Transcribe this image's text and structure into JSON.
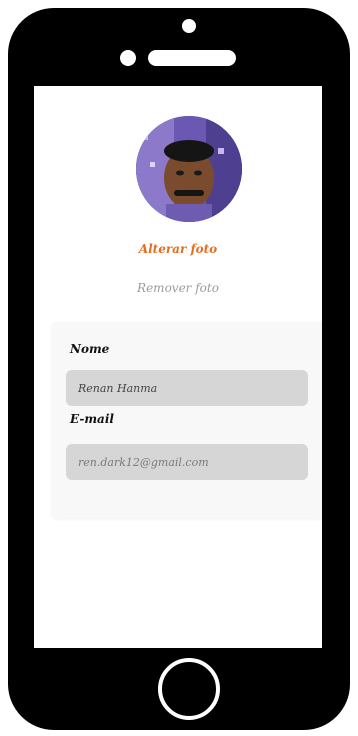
{
  "profile": {
    "change_photo_label": "Alterar foto",
    "remove_photo_label": "Remover foto"
  },
  "form": {
    "name_label": "Nome",
    "name_value": "Renan Hanma",
    "email_label": "E-mail",
    "email_value": "ren.dark12@gmail.com"
  },
  "colors": {
    "accent": "#e26f1f",
    "muted_text": "#9b9b9b",
    "input_bg": "#d6d6d6",
    "card_bg": "#f8f8f8"
  },
  "icons": {
    "avatar": "user-photo"
  }
}
